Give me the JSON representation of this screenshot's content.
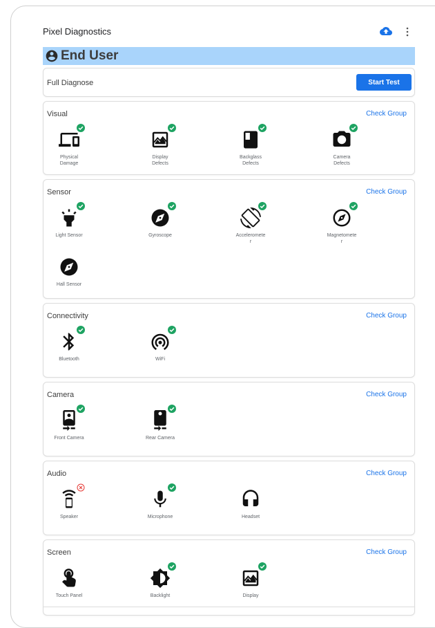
{
  "app": {
    "title": "Pixel Diagnostics"
  },
  "role": {
    "label": "End User"
  },
  "full_diagnose": {
    "title": "Full Diagnose",
    "button": "Start Test"
  },
  "colors": {
    "accent": "#1a73e8",
    "pass": "#1ea362",
    "fail": "#e53935",
    "role_bg": "#a9d4fb"
  },
  "groups": [
    {
      "title": "Visual",
      "check": "Check Group",
      "items": [
        {
          "label": "Physical\nDamage",
          "icon": "devices-icon",
          "status": "pass"
        },
        {
          "label": "Display\nDefects",
          "icon": "image-icon",
          "status": "pass"
        },
        {
          "label": "Backglass\nDefects",
          "icon": "book-icon",
          "status": "pass"
        },
        {
          "label": "Camera\nDefects",
          "icon": "camera-icon",
          "status": "pass"
        }
      ]
    },
    {
      "title": "Sensor",
      "check": "Check Group",
      "items": [
        {
          "label": "Light Sensor",
          "icon": "highlight-icon",
          "status": "pass"
        },
        {
          "label": "Gyroscope",
          "icon": "compass-filled-icon",
          "status": "pass"
        },
        {
          "label": "Acceleromete\nr",
          "icon": "screen-rotation-icon",
          "status": "pass"
        },
        {
          "label": "Magnetomete\nr",
          "icon": "compass-outline-icon",
          "status": "pass"
        },
        {
          "label": "Hall Sensor",
          "icon": "compass-filled-icon",
          "status": "none"
        }
      ]
    },
    {
      "title": "Connectivity",
      "check": "Check Group",
      "items": [
        {
          "label": "Bluetooth",
          "icon": "bluetooth-icon",
          "status": "pass"
        },
        {
          "label": "WiFi",
          "icon": "wifi-tethering-icon",
          "status": "pass"
        }
      ]
    },
    {
      "title": "Camera",
      "check": "Check Group",
      "items": [
        {
          "label": "Front Camera",
          "icon": "camera-front-icon",
          "status": "pass"
        },
        {
          "label": "Rear Camera",
          "icon": "camera-rear-icon",
          "status": "pass"
        }
      ]
    },
    {
      "title": "Audio",
      "check": "Check Group",
      "items": [
        {
          "label": "Speaker",
          "icon": "speaker-icon",
          "status": "fail"
        },
        {
          "label": "Microphone",
          "icon": "mic-icon",
          "status": "pass"
        },
        {
          "label": "Headset",
          "icon": "headset-icon",
          "status": "none"
        }
      ]
    },
    {
      "title": "Screen",
      "check": "Check Group",
      "items": [
        {
          "label": "Touch Panel",
          "icon": "touch-icon",
          "status": "none"
        },
        {
          "label": "Backlight",
          "icon": "brightness-icon",
          "status": "pass"
        },
        {
          "label": "Display",
          "icon": "image-icon",
          "status": "pass"
        }
      ]
    }
  ]
}
